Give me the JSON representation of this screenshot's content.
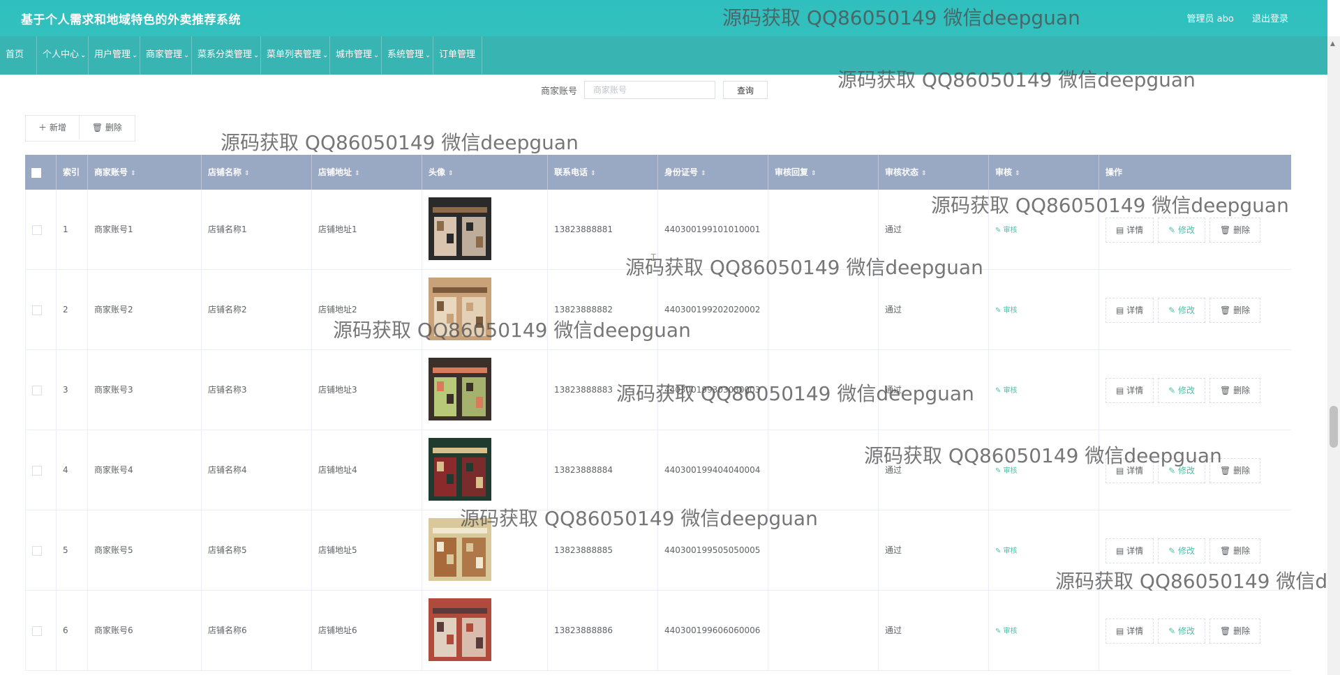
{
  "header": {
    "title": "基于个人需求和地域特色的外卖推荐系统",
    "user_label": "管理员 abo",
    "logout_label": "退出登录"
  },
  "nav": {
    "items": [
      {
        "label": "首页"
      },
      {
        "label": "个人中心"
      },
      {
        "label": "用户管理"
      },
      {
        "label": "商家管理"
      },
      {
        "label": "菜系分类管理"
      },
      {
        "label": "菜单列表管理"
      },
      {
        "label": "城市管理"
      },
      {
        "label": "系统管理"
      },
      {
        "label": "订单管理"
      }
    ]
  },
  "search": {
    "label": "商家账号",
    "placeholder": "商家账号",
    "button": "查询"
  },
  "toolbar": {
    "add_label": "＋ 新增",
    "delete_label": "🗑 删除"
  },
  "table": {
    "headers": [
      "",
      "索引",
      "商家账号",
      "店铺名称",
      "店铺地址",
      "头像",
      "联系电话",
      "身份证号",
      "审核回复",
      "审核状态",
      "审核",
      "操作"
    ],
    "rows": [
      {
        "index": "1",
        "account": "商家账号1",
        "shop": "店铺名称1",
        "address": "店铺地址1",
        "phone": "13823888881",
        "id_card": "440300199101010001",
        "reply": "",
        "status": "通过"
      },
      {
        "index": "2",
        "account": "商家账号2",
        "shop": "店铺名称2",
        "address": "店铺地址2",
        "phone": "13823888882",
        "id_card": "440300199202020002",
        "reply": "",
        "status": "通过"
      },
      {
        "index": "3",
        "account": "商家账号3",
        "shop": "店铺名称3",
        "address": "店铺地址3",
        "phone": "13823888883",
        "id_card": "440300199303030003",
        "reply": "",
        "status": "通过"
      },
      {
        "index": "4",
        "account": "商家账号4",
        "shop": "店铺名称4",
        "address": "店铺地址4",
        "phone": "13823888884",
        "id_card": "440300199404040004",
        "reply": "",
        "status": "通过"
      },
      {
        "index": "5",
        "account": "商家账号5",
        "shop": "店铺名称5",
        "address": "店铺地址5",
        "phone": "13823888885",
        "id_card": "440300199505050005",
        "reply": "",
        "status": "通过"
      },
      {
        "index": "6",
        "account": "商家账号6",
        "shop": "店铺名称6",
        "address": "店铺地址6",
        "phone": "13823888886",
        "id_card": "440300199606060006",
        "reply": "",
        "status": "通过"
      }
    ],
    "audit_label": "✎ 审核",
    "detail_label": "▤ 详情",
    "edit_label": "✎ 修改",
    "delete_label": "🗑 删除"
  },
  "watermark": "源码获取 QQ86050149 微信deepguan",
  "colors": {
    "header_bg": "#33c1bf",
    "nav_bg": "#38b5b3",
    "table_header_bg": "#99a8c3",
    "accent_green": "#4cbfa8"
  }
}
